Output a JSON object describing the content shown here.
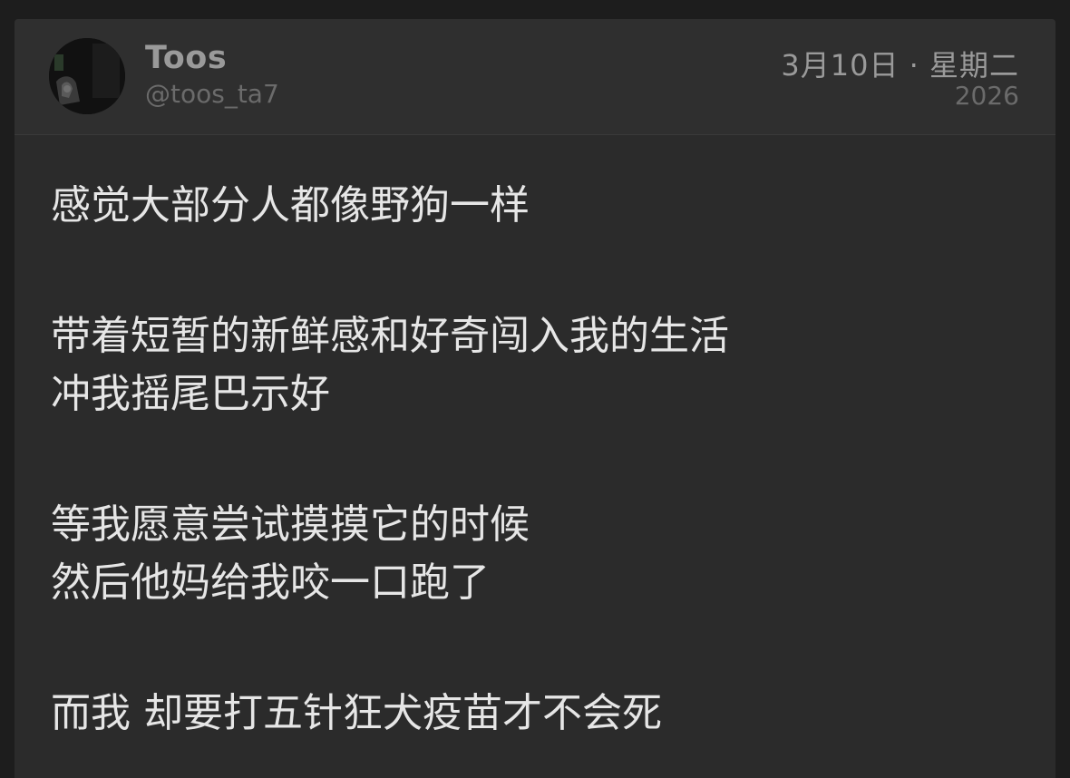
{
  "post": {
    "author": {
      "display_name": "Toos",
      "handle": "@toos_ta7"
    },
    "date": "3月10日 · 星期二",
    "year": "2026",
    "paragraphs": [
      {
        "lines": [
          "感觉大部分人都像野狗一样"
        ]
      },
      {
        "lines": [
          "带着短暂的新鲜感和好奇闯入我的生活",
          "冲我摇尾巴示好"
        ]
      },
      {
        "lines": [
          "等我愿意尝试摸摸它的时候",
          "然后他妈给我咬一口跑了"
        ]
      },
      {
        "lines": [
          "而我 却要打五针狂犬疫苗才不会死"
        ]
      }
    ]
  }
}
